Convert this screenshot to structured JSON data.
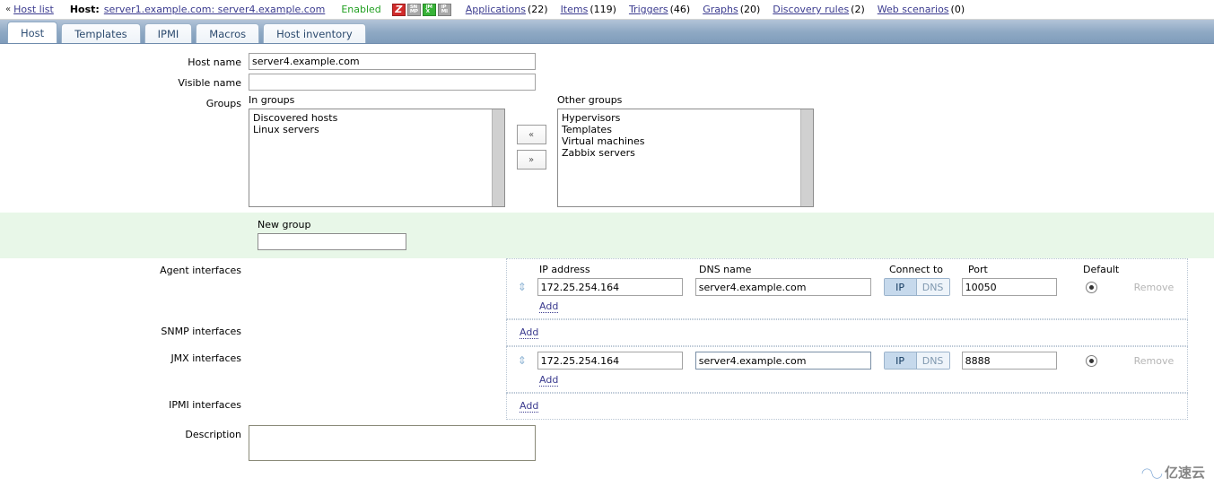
{
  "topbar": {
    "back_chevron": "«",
    "host_list_link": "Host list",
    "host_label": "Host:",
    "host_link": "server1.example.com: server4.example.com",
    "status": "Enabled",
    "badges": [
      {
        "name": "zabbix-agent-badge",
        "text": "Z",
        "color": "#d12b2b"
      },
      {
        "name": "snmp-badge",
        "line1": "SN",
        "line2": "MP",
        "color": "#a8a8a8"
      },
      {
        "name": "jmx-badge",
        "line1": "JM",
        "line2": "X",
        "color": "#37b337"
      },
      {
        "name": "ipmi-badge",
        "line1": "IP",
        "line2": "MI",
        "color": "#a8a8a8"
      }
    ],
    "links": [
      {
        "label": "Applications",
        "count": "(22)"
      },
      {
        "label": "Items",
        "count": "(119)"
      },
      {
        "label": "Triggers",
        "count": "(46)"
      },
      {
        "label": "Graphs",
        "count": "(20)"
      },
      {
        "label": "Discovery rules",
        "count": "(2)"
      },
      {
        "label": "Web scenarios",
        "count": "(0)"
      }
    ]
  },
  "tabs": [
    {
      "label": "Host",
      "active": true
    },
    {
      "label": "Templates",
      "active": false
    },
    {
      "label": "IPMI",
      "active": false
    },
    {
      "label": "Macros",
      "active": false
    },
    {
      "label": "Host inventory",
      "active": false
    }
  ],
  "form": {
    "host_name": {
      "label": "Host name",
      "value": "server4.example.com"
    },
    "visible_name": {
      "label": "Visible name",
      "value": ""
    },
    "groups": {
      "label": "Groups",
      "in_groups_caption": "In groups",
      "in_groups": [
        "Discovered hosts",
        "Linux servers"
      ],
      "other_groups_caption": "Other groups",
      "other_groups": [
        "Hypervisors",
        "Templates",
        "Virtual machines",
        "Zabbix servers"
      ],
      "move_left": "«",
      "move_right": "»"
    },
    "new_group": {
      "label": "New group",
      "value": ""
    },
    "interface_columns": {
      "ip": "IP address",
      "dns": "DNS name",
      "connect_to": "Connect to",
      "port": "Port",
      "default": "Default"
    },
    "connect_options": {
      "ip": "IP",
      "dns": "DNS"
    },
    "remove_label": "Remove",
    "add_label": "Add",
    "agent_interfaces": {
      "label": "Agent interfaces",
      "rows": [
        {
          "ip": "172.25.254.164",
          "dns": "server4.example.com",
          "connect": "IP",
          "port": "10050",
          "default": true,
          "focused": false
        }
      ]
    },
    "snmp_interfaces": {
      "label": "SNMP interfaces",
      "rows": []
    },
    "jmx_interfaces": {
      "label": "JMX interfaces",
      "rows": [
        {
          "ip": "172.25.254.164",
          "dns": "server4.example.com",
          "connect": "IP",
          "port": "8888",
          "default": true,
          "focused": true
        }
      ]
    },
    "ipmi_interfaces": {
      "label": "IPMI interfaces",
      "rows": []
    },
    "description": {
      "label": "Description",
      "value": ""
    }
  },
  "watermark": {
    "glyph": "◠◡",
    "text": "亿速云"
  }
}
